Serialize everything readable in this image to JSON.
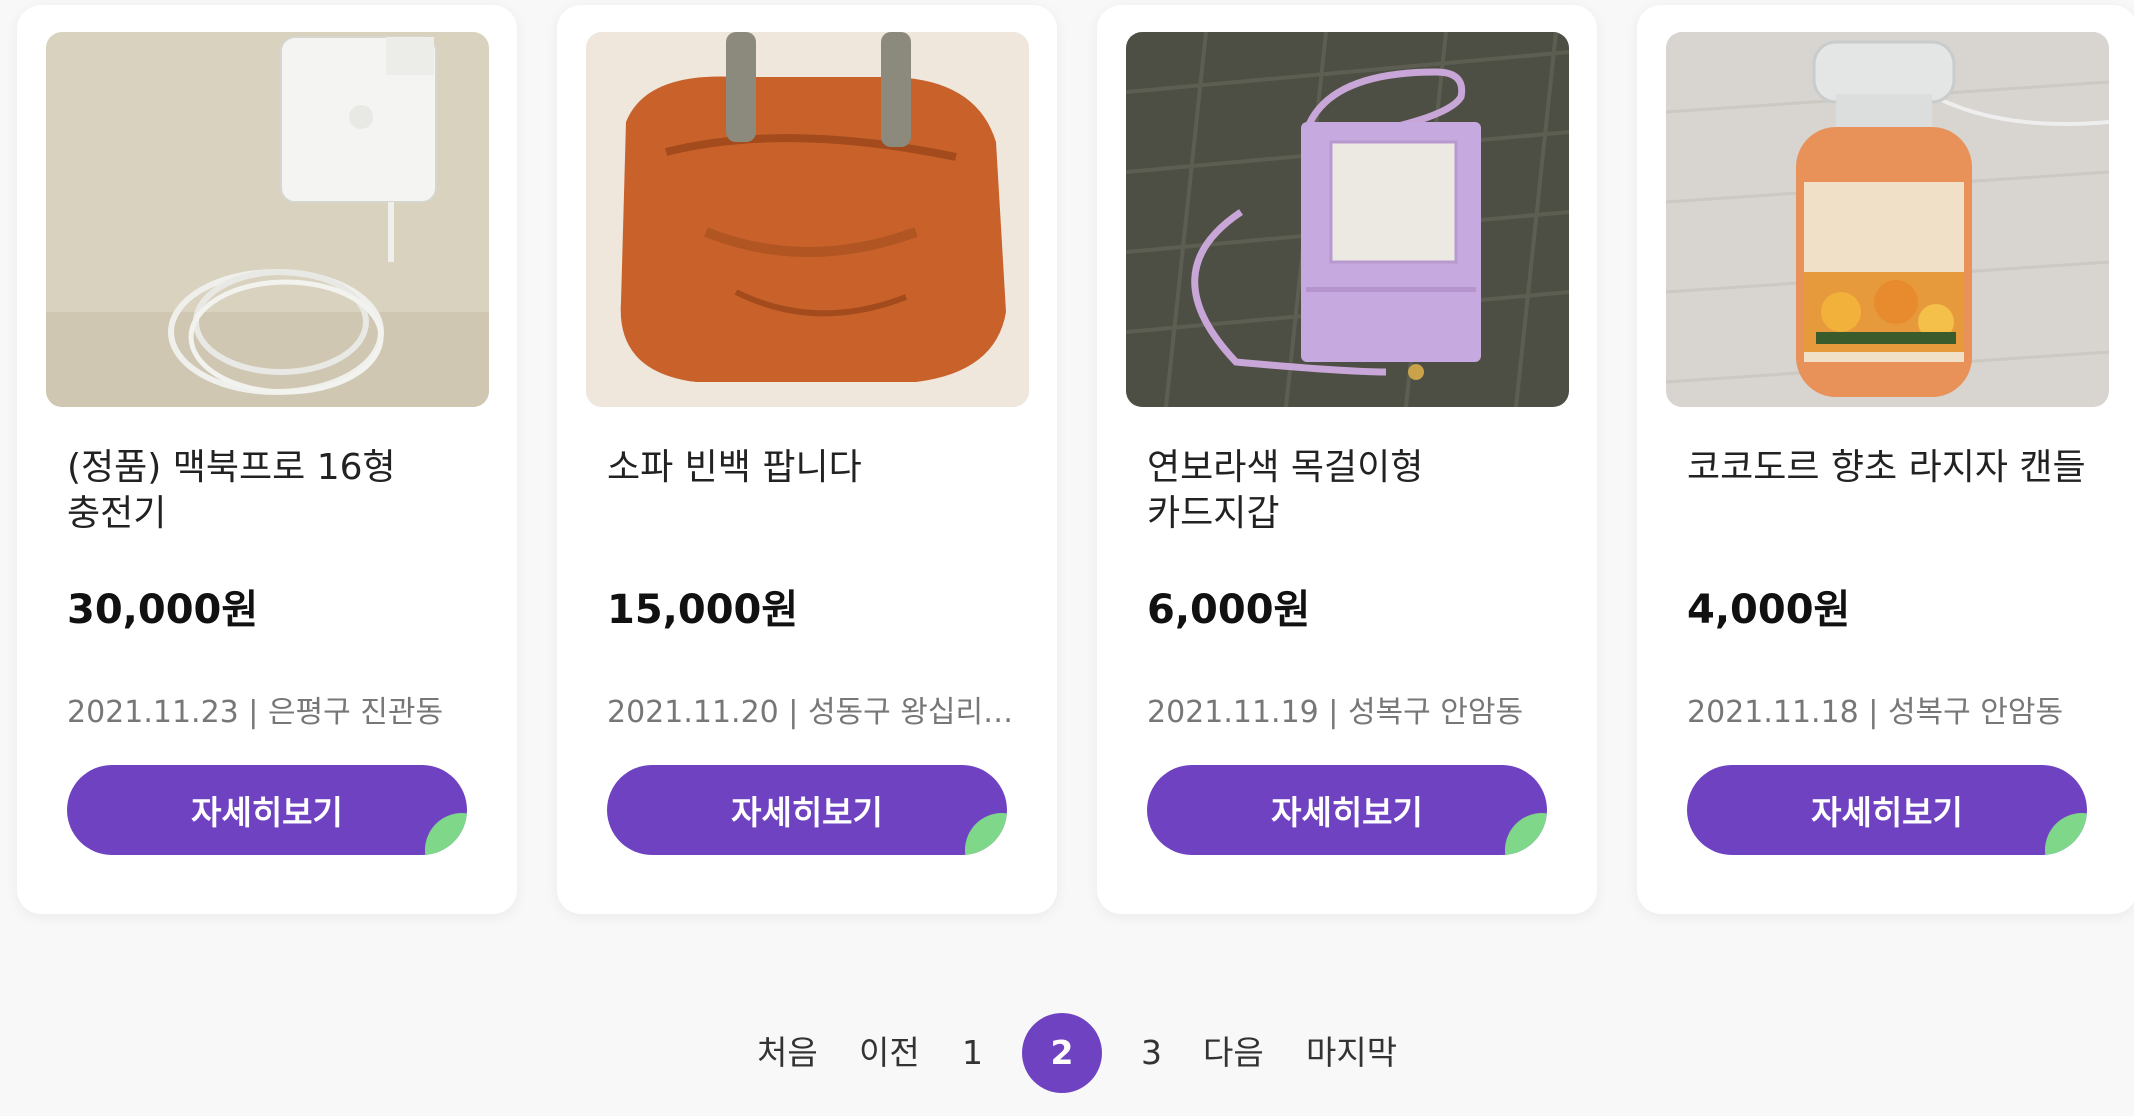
{
  "products": [
    {
      "title": "(정품) 맥북프로 16형\n충전기",
      "price": "30,000원",
      "meta": "2021.11.23 | 은평구 진관동",
      "button_label": "자세히보기"
    },
    {
      "title": "소파 빈백 팝니다",
      "price": "15,000원",
      "meta": "2021.11.20 | 성동구 왕십리…",
      "button_label": "자세히보기"
    },
    {
      "title": "연보라색 목걸이형\n카드지갑",
      "price": "6,000원",
      "meta": "2021.11.19 | 성복구 안암동",
      "button_label": "자세히보기"
    },
    {
      "title": "코코도르 향초 라지자 캔들",
      "price": "4,000원",
      "meta": "2021.11.18 | 성복구 안암동",
      "button_label": "자세히보기"
    }
  ],
  "pagination": {
    "first": "처음",
    "prev": "이전",
    "pages": [
      "1",
      "2",
      "3"
    ],
    "current": "2",
    "next": "다음",
    "last": "마지막"
  },
  "colors": {
    "accent": "#6f42c1",
    "corner_accent": "#7fd88a"
  }
}
